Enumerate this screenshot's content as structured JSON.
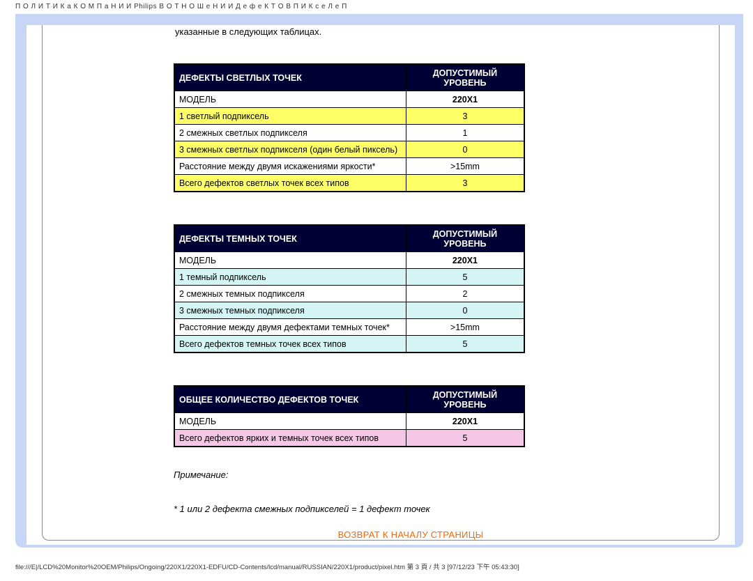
{
  "header": "П О Л И Т И К а   К О М П а Н И И Philips  В   О Т Н О Ш е Н И И   Д е ф е К Т О В   П И К с е Л е П",
  "intro": "указанные в следующих таблицах.",
  "tables": {
    "bright": {
      "header_left": "ДЕФЕКТЫ СВЕТЛЫХ ТОЧЕК",
      "header_right": "ДОПУСТИМЫЙ УРОВЕНЬ",
      "rows": [
        {
          "label": "МОДЕЛЬ",
          "value": "220X1"
        },
        {
          "label": "1 светлый подпиксель",
          "value": "3"
        },
        {
          "label": "2 смежных светлых подпикселя",
          "value": "1"
        },
        {
          "label": "3 смежных светлых подпикселя (один белый пиксель)",
          "value": "0"
        },
        {
          "label": "Расстояние между двумя искажениями яркости*",
          "value": ">15mm"
        },
        {
          "label": "Всего дефектов светлых точек всех типов",
          "value": "3"
        }
      ]
    },
    "dark": {
      "header_left": "ДЕФЕКТЫ ТЕМНЫХ ТОЧЕК",
      "header_right": "ДОПУСТИМЫЙ УРОВЕНЬ",
      "rows": [
        {
          "label": "МОДЕЛЬ",
          "value": "220X1"
        },
        {
          "label": "1 темный подпиксель",
          "value": "5"
        },
        {
          "label": "2 смежных темных подпикселя",
          "value": "2"
        },
        {
          "label": "3 смежных темных подпикселя",
          "value": "0"
        },
        {
          "label": "Расстояние между двумя дефектами темных точек*",
          "value": ">15mm"
        },
        {
          "label": "Всего дефектов темных точек всех типов",
          "value": "5"
        }
      ]
    },
    "total": {
      "header_left": "ОБЩЕЕ КОЛИЧЕСТВО ДЕФЕКТОВ ТОЧЕК",
      "header_right": "ДОПУСТИМЫЙ УРОВЕНЬ",
      "rows": [
        {
          "label": "МОДЕЛЬ",
          "value": "220X1"
        },
        {
          "label": "Всего дефектов ярких и темных точек всех типов",
          "value": "5"
        }
      ]
    }
  },
  "note": {
    "label": "Примечание:",
    "text": "* 1 или 2 дефекта смежных подпикселей = 1 дефект точек"
  },
  "back_to_top": "ВОЗВРАТ К НАЧАЛУ СТРАНИЦЫ",
  "footer": "file:///E|/LCD%20Monitor%20OEM/Philips/Ongoing/220X1/220X1-EDFU/CD-Contents/lcd/manual/RUSSIAN/220X1/product/pixel.htm 第 3 頁 / 共 3  [97/12/23 下午 05:43:30]"
}
